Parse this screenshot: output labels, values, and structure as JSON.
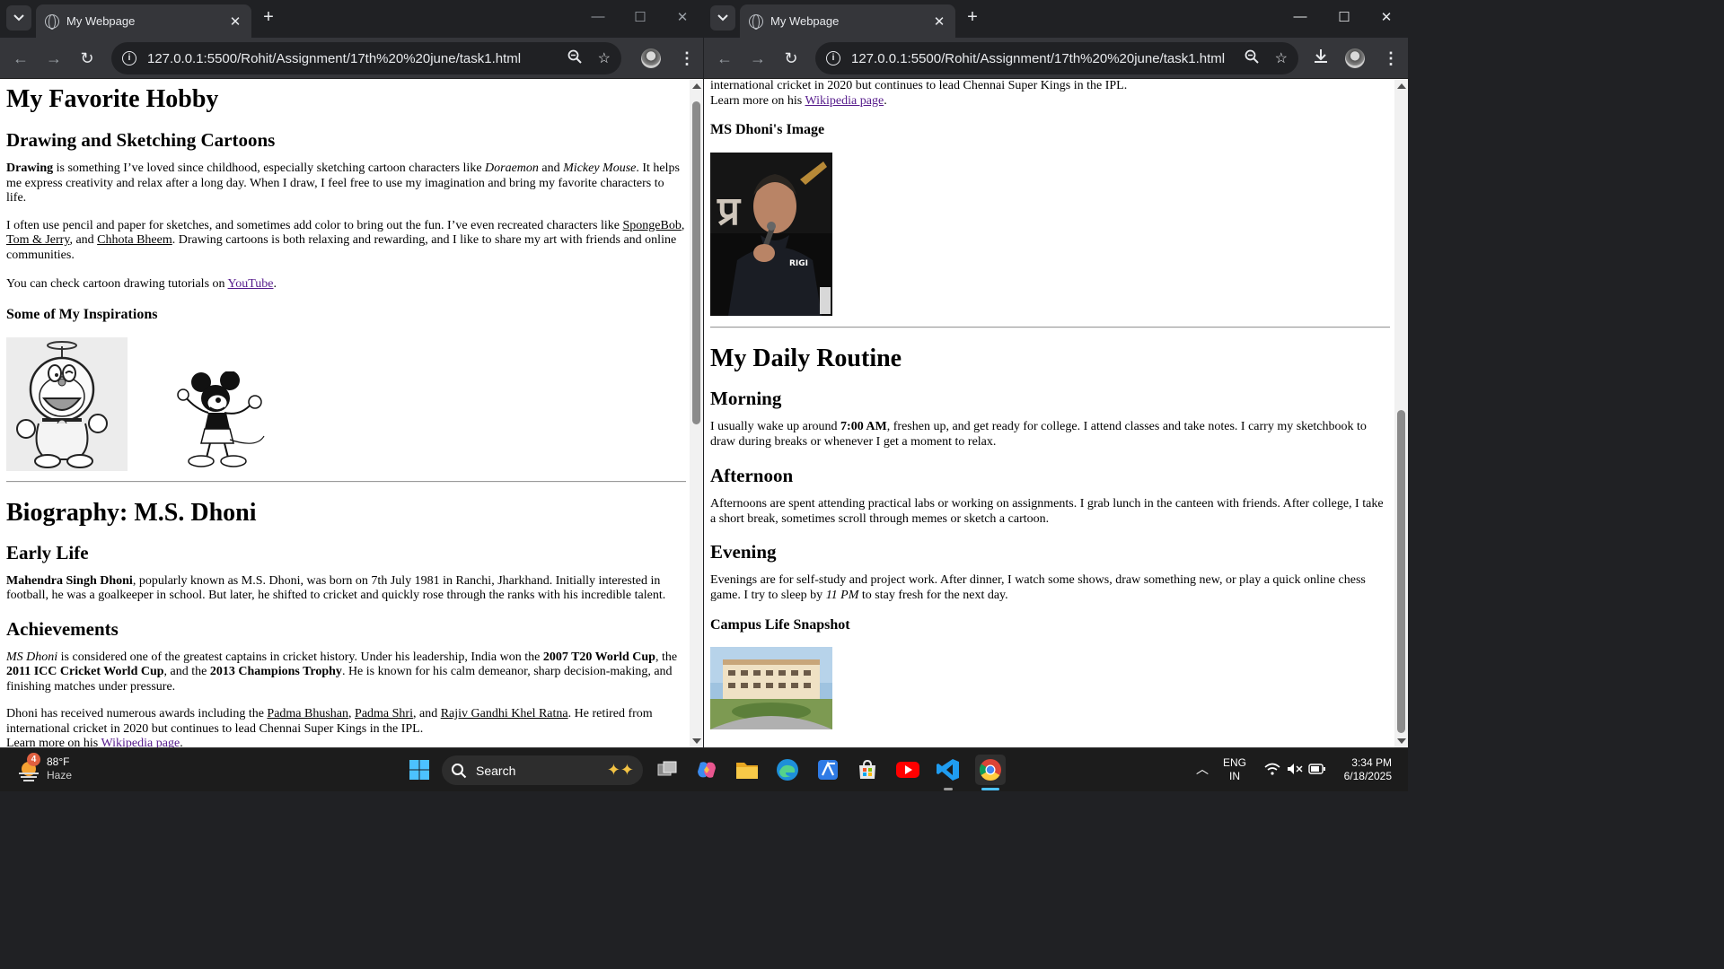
{
  "left_browser": {
    "tab_title": "My Webpage",
    "url": "127.0.0.1:5500/Rohit/Assignment/17th%20%20june/task1.html",
    "page": {
      "h1_hobby": "My Favorite Hobby",
      "h2_drawing": "Drawing and Sketching Cartoons",
      "p1": {
        "b1": "Drawing",
        "t1": " is something I’ve loved since childhood, especially sketching cartoon characters like ",
        "i1": "Doraemon",
        "t2": " and ",
        "i2": "Mickey Mouse",
        "t3": ". It helps me express creativity and relax after a long day. When I draw, I feel free to use my imagination and bring my favorite characters to life."
      },
      "p2": {
        "t1": "I often use pencil and paper for sketches, and sometimes add color to bring out the fun. I’ve even recreated characters like ",
        "l1": "SpongeBob",
        "t2": ", ",
        "l2": "Tom & Jerry",
        "t3": ", and ",
        "l3": "Chhota Bheem",
        "t4": ". Drawing cartoons is both relaxing and rewarding, and I like to share my art with friends and online communities."
      },
      "p3": {
        "t1": "You can check cartoon drawing tutorials on ",
        "l1": "YouTube",
        "t2": "."
      },
      "h3_inspirations": "Some of My Inspirations",
      "h1_bio": "Biography: M.S. Dhoni",
      "h2_early": "Early Life",
      "p4": {
        "b1": "Mahendra Singh Dhoni",
        "t1": ", popularly known as M.S. Dhoni, was born on 7th July 1981 in Ranchi, Jharkhand. Initially interested in football, he was a goalkeeper in school. But later, he shifted to cricket and quickly rose through the ranks with his incredible talent."
      },
      "h2_achievements": "Achievements",
      "p5": {
        "i1": "MS Dhoni",
        "t1": " is considered one of the greatest captains in cricket history. Under his leadership, India won the ",
        "b1": "2007 T20 World Cup",
        "t2": ", the ",
        "b2": "2011 ICC Cricket World Cup",
        "t3": ", and the ",
        "b3": "2013 Champions Trophy",
        "t4": ". He is known for his calm demeanor, sharp decision-making, and finishing matches under pressure."
      },
      "p6": {
        "t1": "Dhoni has received numerous awards including the ",
        "l1": "Padma Bhushan",
        "t2": ", ",
        "l2": "Padma Shri",
        "t3": ", and ",
        "l3": "Rajiv Gandhi Khel Ratna",
        "t4": ". He retired from international cricket in 2020 but continues to lead Chennai Super Kings in the IPL.",
        "t5": "Learn more on his ",
        "l4": "Wikipedia page",
        "t6": "."
      }
    }
  },
  "right_browser": {
    "tab_title": "My Webpage",
    "url": "127.0.0.1:5500/Rohit/Assignment/17th%20%20june/task1.html",
    "page": {
      "p_top": "international cricket in 2020 but continues to lead Chennai Super Kings in the IPL.",
      "p_learn": {
        "t1": "Learn more on his ",
        "l1": "Wikipedia page",
        "t2": "."
      },
      "h3_dhoni": "MS Dhoni's Image",
      "dhoni_shirt_text": "RIGI",
      "h1_routine": "My Daily Routine",
      "h2_morning": "Morning",
      "p_morning": {
        "t1": "I usually wake up around ",
        "b1": "7:00 AM",
        "t2": ", freshen up, and get ready for college. I attend classes and take notes. I carry my sketchbook to draw during breaks or whenever I get a moment to relax."
      },
      "h2_afternoon": "Afternoon",
      "p_afternoon": "Afternoons are spent attending practical labs or working on assignments. I grab lunch in the canteen with friends. After college, I take a short break, sometimes scroll through memes or sketch a cartoon.",
      "h2_evening": "Evening",
      "p_evening": {
        "t1": "Evenings are for self-study and project work. After dinner, I watch some shows, draw something new, or play a quick online chess game. I try to sleep by ",
        "i1": "11 PM",
        "t2": " to stay fresh for the next day."
      },
      "h3_campus": "Campus Life Snapshot"
    }
  },
  "taskbar": {
    "weather_badge": "4",
    "temperature": "88°F",
    "condition": "Haze",
    "search_label": "Search",
    "language": "ENG",
    "region": "IN",
    "time": "3:34 PM",
    "date": "6/18/2025"
  },
  "icons": [
    "tab-list-icon",
    "globe-icon",
    "close-icon",
    "plus-icon",
    "minimize-icon",
    "maximize-icon",
    "back-icon",
    "forward-icon",
    "reload-icon",
    "info-icon",
    "zoom-icon",
    "star-icon",
    "download-icon",
    "menu-icon",
    "windows-start-icon",
    "search-icon",
    "task-view-icon",
    "copilot-icon",
    "file-explorer-icon",
    "edge-icon",
    "store-icon",
    "youtube-icon",
    "vscode-icon",
    "chrome-icon",
    "wifi-icon",
    "volume-muted-icon",
    "battery-icon",
    "chevron-up-icon"
  ],
  "colors": {
    "chrome_dark": "#202124",
    "chrome_toolbar": "#35363a",
    "visited_link": "#551a8b",
    "taskbar": "#1c1c1c"
  }
}
